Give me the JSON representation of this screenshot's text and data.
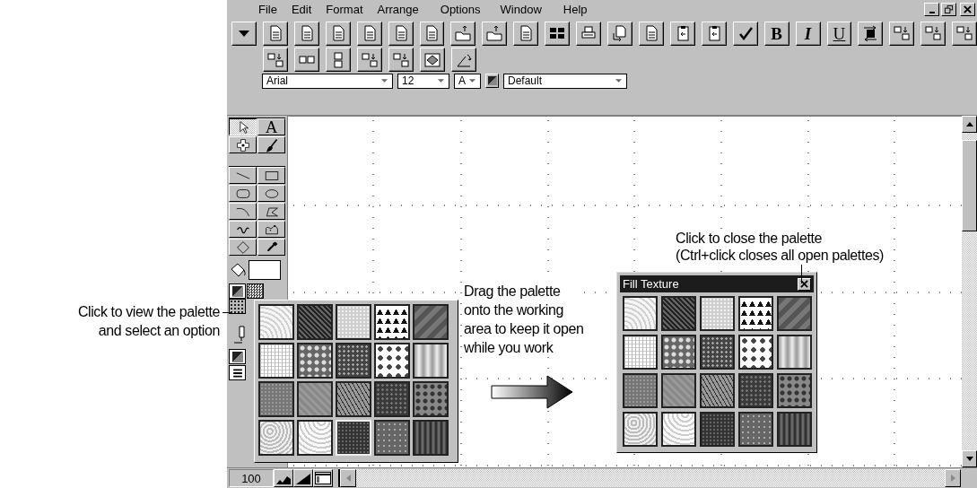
{
  "window": {
    "menu": [
      "File",
      "Edit",
      "Format",
      "Arrange",
      "Options",
      "Window",
      "Help"
    ],
    "controls": [
      {
        "kind": "minimize"
      },
      {
        "kind": "restore"
      },
      {
        "kind": "close"
      }
    ]
  },
  "toolbar": {
    "row1": [
      {
        "kind": "dropdown"
      },
      {
        "kind": "doc"
      },
      {
        "kind": "doc"
      },
      {
        "kind": "doc"
      },
      {
        "kind": "doc"
      },
      {
        "kind": "doc"
      },
      {
        "kind": "doc"
      },
      {
        "kind": "folder"
      },
      {
        "kind": "folder"
      },
      {
        "kind": "doc"
      },
      {
        "kind": "grid"
      },
      {
        "kind": "printer"
      },
      {
        "kind": "page"
      },
      {
        "kind": "doc"
      },
      {
        "kind": "clip"
      },
      {
        "kind": "clip"
      },
      {
        "kind": "spell"
      },
      {
        "kind": "bold",
        "label": "B"
      },
      {
        "kind": "italic",
        "label": "I"
      },
      {
        "kind": "underline",
        "label": "U"
      },
      {
        "kind": "swap"
      },
      {
        "kind": "squares"
      },
      {
        "kind": "squares"
      },
      {
        "kind": "squares"
      }
    ],
    "row2": [
      {
        "kind": "squares"
      },
      {
        "kind": "pair"
      },
      {
        "kind": "stack"
      },
      {
        "kind": "squares"
      },
      {
        "kind": "squares"
      },
      {
        "kind": "fit"
      },
      {
        "kind": "rotate"
      }
    ]
  },
  "format_bar": {
    "font": "Arial",
    "size": "12",
    "text_color": "A",
    "style": "Default"
  },
  "toolbox": {
    "groups": [
      {
        "tools": [
          {
            "kind": "pointer",
            "selected": true
          },
          {
            "kind": "text",
            "label": "A",
            "selected": false
          },
          {
            "kind": "cross",
            "selected": false
          },
          {
            "kind": "brush",
            "selected": false
          }
        ]
      },
      {
        "tools": [
          {
            "kind": "line",
            "selected": false
          },
          {
            "kind": "rect",
            "selected": false
          },
          {
            "kind": "rrect",
            "selected": false
          },
          {
            "kind": "ellipse",
            "selected": false
          },
          {
            "kind": "curve",
            "selected": false
          },
          {
            "kind": "polygon",
            "selected": false
          },
          {
            "kind": "freehand",
            "selected": false
          },
          {
            "kind": "shape",
            "selected": false
          },
          {
            "kind": "diamond",
            "selected": false
          },
          {
            "kind": "dropper",
            "selected": false
          }
        ]
      }
    ]
  },
  "palette_popup": {
    "tiles": [
      {
        "selected": false
      },
      {
        "selected": false
      },
      {
        "selected": false
      },
      {
        "selected": false
      },
      {
        "selected": false
      },
      {
        "selected": false
      },
      {
        "selected": false
      },
      {
        "selected": false
      },
      {
        "selected": false
      },
      {
        "selected": false
      },
      {
        "selected": false
      },
      {
        "selected": false
      },
      {
        "selected": false
      },
      {
        "selected": false
      },
      {
        "selected": false
      },
      {
        "selected": false
      },
      {
        "selected": false
      },
      {
        "selected": true
      },
      {
        "selected": false
      },
      {
        "selected": false
      }
    ]
  },
  "floating_palette": {
    "title": "Fill Texture",
    "tiles": [
      {
        "selected": false
      },
      {
        "selected": false
      },
      {
        "selected": false
      },
      {
        "selected": false
      },
      {
        "selected": false
      },
      {
        "selected": false
      },
      {
        "selected": false
      },
      {
        "selected": false
      },
      {
        "selected": false
      },
      {
        "selected": false
      },
      {
        "selected": false
      },
      {
        "selected": false
      },
      {
        "selected": false
      },
      {
        "selected": false
      },
      {
        "selected": false
      },
      {
        "selected": false
      },
      {
        "selected": false
      },
      {
        "selected": false
      },
      {
        "selected": false
      },
      {
        "selected": false
      }
    ]
  },
  "status_bar": {
    "zoom": "100"
  },
  "callouts": [
    {
      "kind": "view",
      "text": "Click to view the palette\nand select an option"
    },
    {
      "kind": "drag",
      "text": "Drag the palette\nonto the working\narea to keep it open\nwhile you work"
    },
    {
      "kind": "close",
      "text": "Click to close the palette\n(Ctrl+click closes all open palettes)"
    }
  ]
}
